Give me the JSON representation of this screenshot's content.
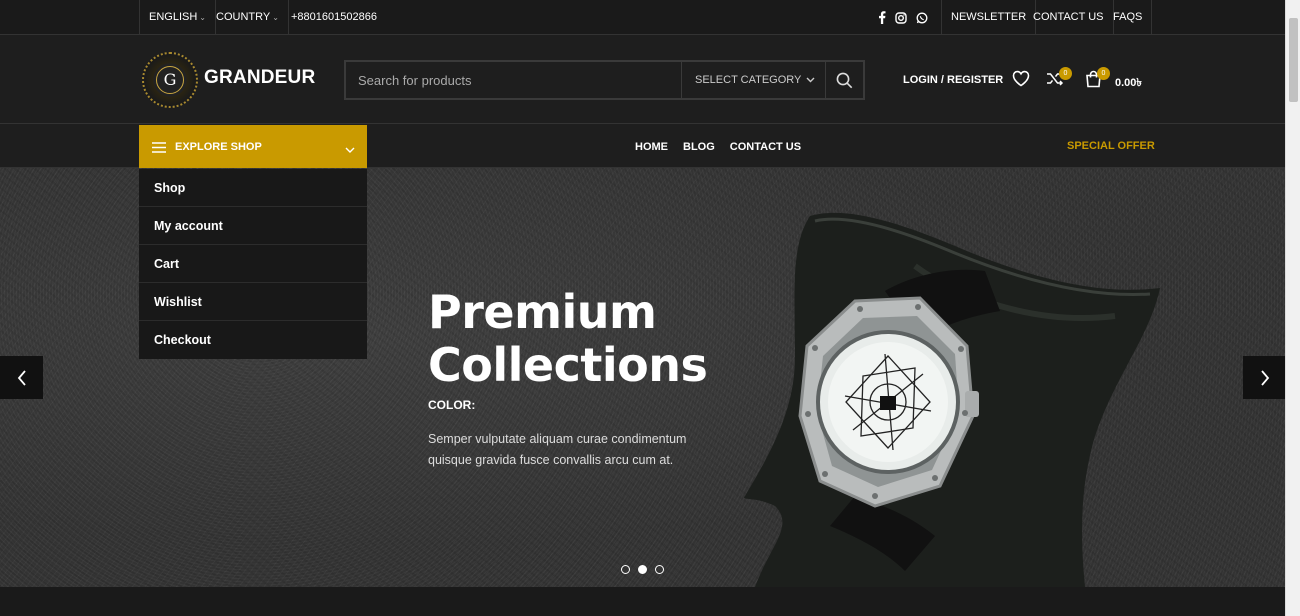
{
  "topbar": {
    "language": "ENGLISH",
    "country": "COUNTRY",
    "phone": "+8801601502866",
    "social": [
      "facebook-icon",
      "instagram-icon",
      "whatsapp-icon"
    ],
    "links": [
      "NEWSLETTER",
      "CONTACT US",
      "FAQS"
    ]
  },
  "header": {
    "logo_letter": "G",
    "logo_text": "GRANDEUR",
    "search_placeholder": "Search for products",
    "category_label": "SELECT CATEGORY",
    "login_label": "LOGIN / REGISTER",
    "compare_count": "0",
    "cart_count": "0",
    "cart_total": "0.00৳"
  },
  "nav": {
    "explore_label": "EXPLORE SHOP",
    "links": [
      "HOME",
      "BLOG",
      "CONTACT US"
    ],
    "special_offer": "SPECIAL OFFER"
  },
  "menu": {
    "items": [
      "Shop",
      "My account",
      "Cart",
      "Wishlist",
      "Checkout"
    ]
  },
  "hero": {
    "title": "Premium Collections",
    "color_label": "COLOR:",
    "description": "Semper vulputate aliquam curae condimentum quisque gravida fusce convallis arcu cum at.",
    "active_slide": 2,
    "slide_count": 3
  },
  "colors": {
    "accent": "#c99a00",
    "background": "#1e1e1e"
  }
}
